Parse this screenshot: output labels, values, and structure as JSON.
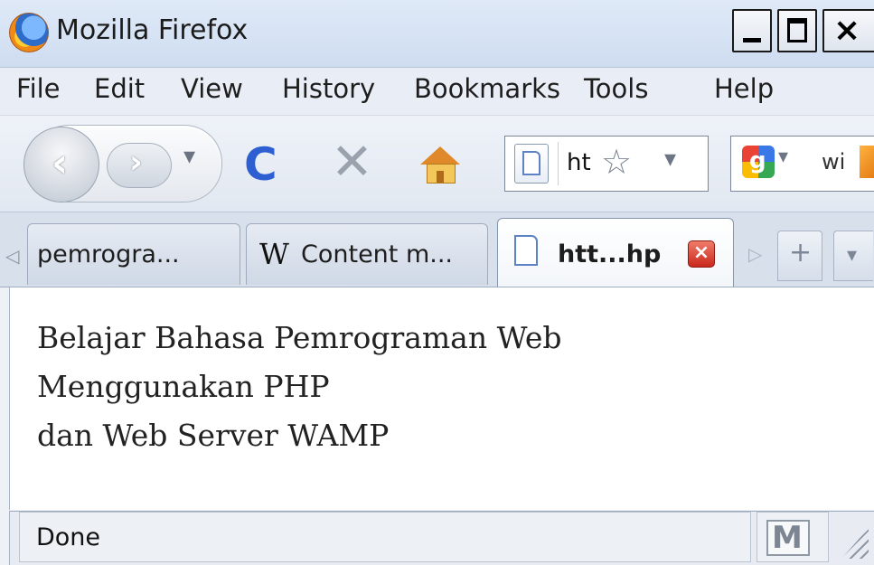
{
  "window": {
    "title": "Mozilla Firefox",
    "close_glyph": "×"
  },
  "menubar": {
    "items": [
      {
        "label": "File"
      },
      {
        "label": "Edit"
      },
      {
        "label": "View"
      },
      {
        "label": "History"
      },
      {
        "label": "Bookmarks"
      },
      {
        "label": "Tools"
      },
      {
        "label": "Help"
      }
    ]
  },
  "navbar": {
    "back_glyph": "‹",
    "forward_glyph": "›",
    "dropdown_glyph": "▾",
    "reload_glyph": "C",
    "stop_glyph": "✕",
    "url_text": "ht",
    "star_glyph": "☆",
    "search_text": "wi"
  },
  "tabs": [
    {
      "label": "pemrogra..."
    },
    {
      "label": "Content m...",
      "icon_text": "W"
    },
    {
      "label": "htt...hp",
      "active": true
    }
  ],
  "tabstrip": {
    "new_tab_glyph": "+",
    "list_glyph": "▾",
    "scroll_left": "◁",
    "scroll_right": "▷"
  },
  "content": {
    "lines": [
      "Belajar Bahasa Pemrograman Web",
      "Menggunakan PHP",
      "dan Web Server WAMP"
    ]
  },
  "statusbar": {
    "text": "Done",
    "gmail_glyph": "M"
  },
  "colors": {
    "titlebar": "#d6e3f4",
    "reload": "#2d5fd2",
    "close_tab": "#c9281c"
  }
}
